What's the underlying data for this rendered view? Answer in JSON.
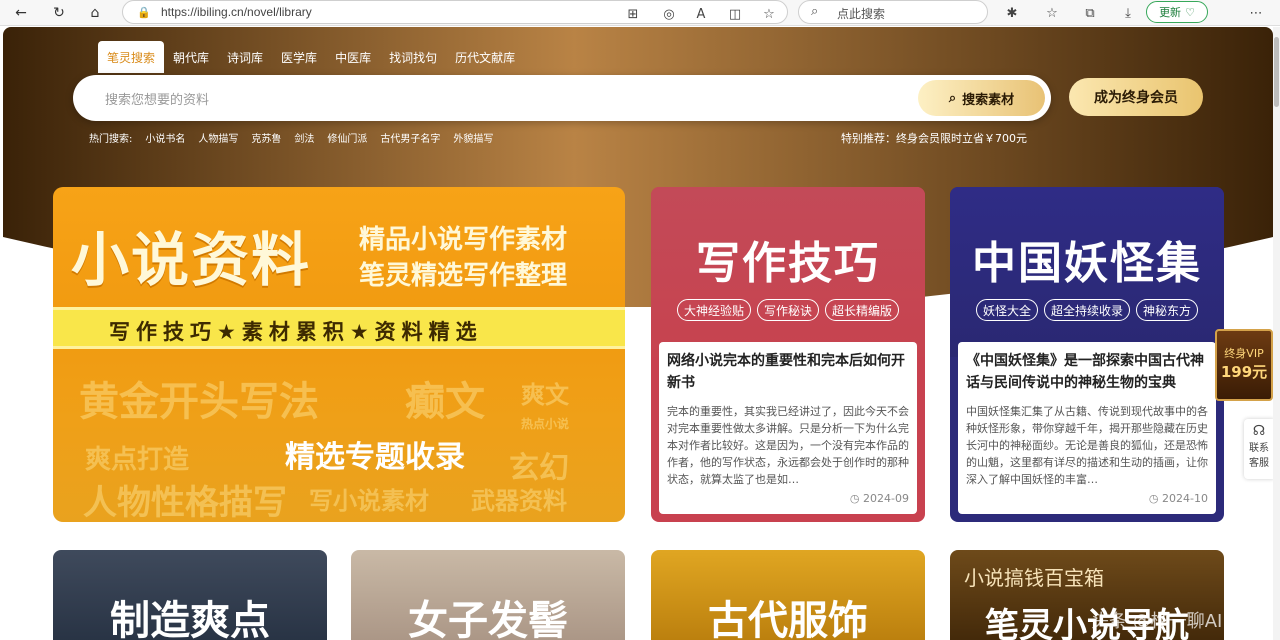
{
  "browser": {
    "url": "https://ibiling.cn/novel/library",
    "search_placeholder": "点此搜索",
    "update_label": "更新"
  },
  "header": {
    "tabs": [
      "笔灵搜索",
      "朝代库",
      "诗词库",
      "医学库",
      "中医库",
      "找词找句",
      "历代文献库"
    ],
    "search_placeholder": "搜索您想要的资料",
    "search_button": "搜索素材",
    "vip_button": "成为终身会员",
    "hot_label": "热门搜索:",
    "hot_terms": [
      "小说书名",
      "人物描写",
      "克苏鲁",
      "剑法",
      "修仙门派",
      "古代男子名字",
      "外貌描写"
    ],
    "promo": "特别推荐：终身会员限时立省￥700元"
  },
  "big_card": {
    "title": "小说资料",
    "line1": "精品小说写作素材",
    "line2": "笔灵精选写作整理",
    "band": "写作技巧★素材累积★资料精选",
    "wm1": "黄金开头写法",
    "wm2": "癫文",
    "wm3": "爽文",
    "wm4": "热点小说",
    "wm5": "爽点打造",
    "wm6": "玄幻",
    "wm7": "人物性格描写",
    "wm8": "写小说素材",
    "wm9": "武器资料",
    "main": "精选专题收录"
  },
  "cards": [
    {
      "title": "写作技巧",
      "chips": [
        "大神经验贴",
        "写作秘诀",
        "超长精编版"
      ],
      "headline": "网络小说完本的重要性和完本后如何开新书",
      "excerpt": "完本的重要性，其实我已经讲过了，因此今天不会对完本重要性做太多讲解。只是分析一下为什么完本对作者比较好。这是因为，一个没有完本作品的作者，他的写作状态，永远都会处于创作时的那种状态，就算太监了也是如…",
      "date": "2024-09",
      "color": "#c8414f"
    },
    {
      "title": "中国妖怪集",
      "chips": [
        "妖怪大全",
        "超全持续收录",
        "神秘东方"
      ],
      "headline": "《中国妖怪集》是一部探索中国古代神话与民间传说中的神秘生物的宝典",
      "excerpt": "中国妖怪集汇集了从古籍、传说到现代故事中的各种妖怪形象，带你穿越千年，揭开那些隐藏在历史长河中的神秘面纱。无论是善良的狐仙，还是恐怖的山魈，这里都有详尽的描述和生动的插画，让你深入了解中国妖怪的丰富…",
      "date": "2024-10",
      "color": "#2c2a7a"
    }
  ],
  "bottom_cards": [
    {
      "title": "制造爽点"
    },
    {
      "title": "女子发髻"
    },
    {
      "title": "古代服饰"
    },
    {
      "title": "笔灵小说导航",
      "sub": "小说搞钱百宝箱"
    }
  ],
  "side": {
    "contact": "联系客服"
  },
  "vip_badge": {
    "top": "终身VIP",
    "price": "199元"
  },
  "watermark": "头条 @桦一聊AI"
}
